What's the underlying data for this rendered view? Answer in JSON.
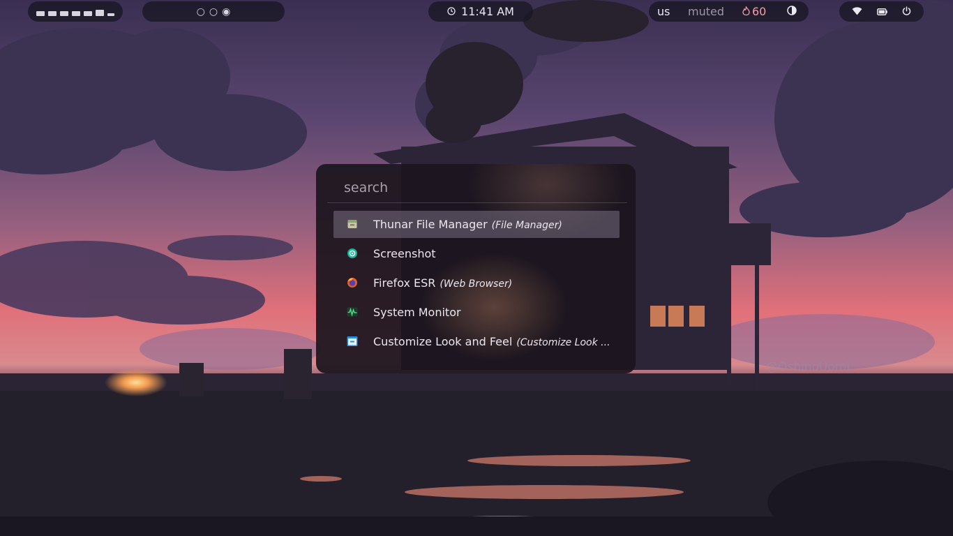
{
  "topbar": {
    "workspaces": {
      "count": 7
    },
    "circles": [
      "○",
      "○",
      "◉"
    ],
    "clock": {
      "icon": "clock-icon",
      "time": "11:41 AM"
    },
    "status": {
      "keyboard_layout": "us",
      "volume": "muted",
      "temperature_icon": "flame-icon",
      "temperature": "60",
      "theme_icon": "contrast-icon"
    },
    "system": {
      "icons": [
        "wifi-icon",
        "battery-icon",
        "power-icon"
      ]
    }
  },
  "wallpaper": {
    "signature": "@OshinoUomi"
  },
  "launcher": {
    "search_placeholder": "search",
    "results": [
      {
        "name": "Thunar File Manager",
        "description": "(File Manager)",
        "icon": "file-manager-icon",
        "selected": true
      },
      {
        "name": "Screenshot",
        "description": "",
        "icon": "screenshot-icon",
        "selected": false
      },
      {
        "name": "Firefox ESR",
        "description": "(Web Browser)",
        "icon": "firefox-icon",
        "selected": false
      },
      {
        "name": "System Monitor",
        "description": "",
        "icon": "system-monitor-icon",
        "selected": false
      },
      {
        "name": "Customize Look and Feel",
        "description": "(Customize Look ...",
        "icon": "customize-look-icon",
        "selected": false
      }
    ]
  },
  "colors": {
    "bar_background": "#1a1624",
    "sky_top": "#3a2f52",
    "sky_horizon": "#e0707a",
    "accent_temperature": "#f2a0a8"
  }
}
